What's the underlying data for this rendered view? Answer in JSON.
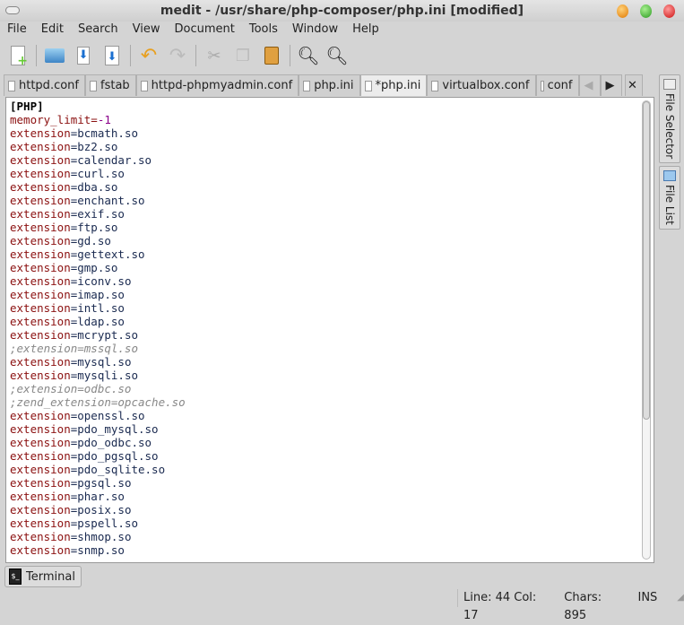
{
  "window": {
    "title": "medit - /usr/share/php-composer/php.ini [modified]"
  },
  "menu": [
    "File",
    "Edit",
    "Search",
    "View",
    "Document",
    "Tools",
    "Window",
    "Help"
  ],
  "tabs": [
    "httpd.conf",
    "fstab",
    "httpd-phpmyadmin.conf",
    "php.ini",
    "*php.ini",
    "virtualbox.conf",
    "conf"
  ],
  "side_panel": {
    "file_selector": "File Selector",
    "file_list": "File List"
  },
  "editor": {
    "lines": [
      {
        "t": "h",
        "a": "[PHP]"
      },
      {
        "t": "kn",
        "a": "memory_limit=",
        "b": "-1"
      },
      {
        "t": "kv",
        "a": "extension",
        "b": "=bcmath.so"
      },
      {
        "t": "kv",
        "a": "extension",
        "b": "=bz2.so"
      },
      {
        "t": "kv",
        "a": "extension",
        "b": "=calendar.so"
      },
      {
        "t": "kv",
        "a": "extension",
        "b": "=curl.so"
      },
      {
        "t": "kv",
        "a": "extension",
        "b": "=dba.so"
      },
      {
        "t": "kv",
        "a": "extension",
        "b": "=enchant.so"
      },
      {
        "t": "kv",
        "a": "extension",
        "b": "=exif.so"
      },
      {
        "t": "kv",
        "a": "extension",
        "b": "=ftp.so"
      },
      {
        "t": "kv",
        "a": "extension",
        "b": "=gd.so"
      },
      {
        "t": "kv",
        "a": "extension",
        "b": "=gettext.so"
      },
      {
        "t": "kv",
        "a": "extension",
        "b": "=gmp.so"
      },
      {
        "t": "kv",
        "a": "extension",
        "b": "=iconv.so"
      },
      {
        "t": "kv",
        "a": "extension",
        "b": "=imap.so"
      },
      {
        "t": "kv",
        "a": "extension",
        "b": "=intl.so"
      },
      {
        "t": "kv",
        "a": "extension",
        "b": "=ldap.so"
      },
      {
        "t": "kv",
        "a": "extension",
        "b": "=mcrypt.so"
      },
      {
        "t": "c",
        "a": ";extension=mssql.so"
      },
      {
        "t": "kv",
        "a": "extension",
        "b": "=mysql.so"
      },
      {
        "t": "kv",
        "a": "extension",
        "b": "=mysqli.so"
      },
      {
        "t": "c",
        "a": ";extension=odbc.so"
      },
      {
        "t": "c",
        "a": ";zend_extension=opcache.so"
      },
      {
        "t": "kv",
        "a": "extension",
        "b": "=openssl.so"
      },
      {
        "t": "kv",
        "a": "extension",
        "b": "=pdo_mysql.so"
      },
      {
        "t": "kv",
        "a": "extension",
        "b": "=pdo_odbc.so"
      },
      {
        "t": "kv",
        "a": "extension",
        "b": "=pdo_pgsql.so"
      },
      {
        "t": "kv",
        "a": "extension",
        "b": "=pdo_sqlite.so"
      },
      {
        "t": "kv",
        "a": "extension",
        "b": "=pgsql.so"
      },
      {
        "t": "kv",
        "a": "extension",
        "b": "=phar.so"
      },
      {
        "t": "kv",
        "a": "extension",
        "b": "=posix.so"
      },
      {
        "t": "kv",
        "a": "extension",
        "b": "=pspell.so"
      },
      {
        "t": "kv",
        "a": "extension",
        "b": "=shmop.so"
      },
      {
        "t": "kv",
        "a": "extension",
        "b": "=snmp.so"
      }
    ]
  },
  "bottom": {
    "terminal": "Terminal"
  },
  "status": {
    "position": "Line: 44 Col: 17",
    "chars": "Chars: 895",
    "mode": "INS"
  }
}
